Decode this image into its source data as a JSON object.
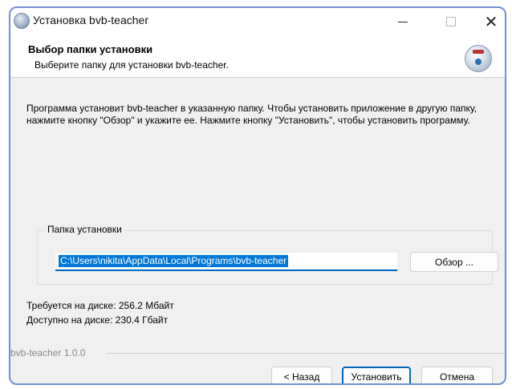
{
  "window": {
    "title": "Установка bvb-teacher",
    "controls": {
      "minimize": "—",
      "close": "✕"
    }
  },
  "header": {
    "title": "Выбор папки установки",
    "subtitle": "Выберите папку для установки bvb-teacher."
  },
  "description": "Программа установит bvb-teacher в указанную папку. Чтобы установить приложение в другую папку, нажмите кнопку \"Обзор\" и укажите ее. Нажмите кнопку \"Установить\", чтобы установить программу.",
  "install_folder": {
    "legend": "Папка установки",
    "path": "C:\\Users\\nikita\\AppData\\Local\\Programs\\bvb-teacher",
    "browse_label": "Обзор ..."
  },
  "space": {
    "required": "Требуется на диске: 256.2 Мбайт",
    "available": "Доступно на диске: 230.4 Гбайт"
  },
  "branding": "bvb-teacher 1.0.0",
  "buttons": {
    "back": "< Назад",
    "install": "Установить",
    "cancel": "Отмена"
  },
  "colors": {
    "accent": "#0067c0",
    "selection": "#0078d7",
    "frame": "#6f8fcf"
  },
  "icons": {
    "title_icon": "installer-globe-icon",
    "header_icon": "installer-disk-icon"
  }
}
